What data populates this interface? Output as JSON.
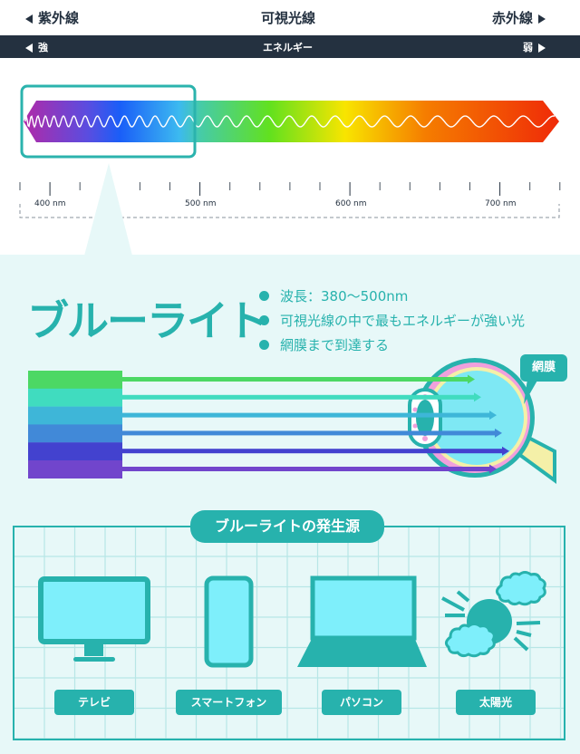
{
  "header": {
    "left_label": "紫外線",
    "center_label": "可視光線",
    "right_label": "赤外線"
  },
  "energy_bar": {
    "left_label": "強",
    "center_label": "エネルギー",
    "right_label": "弱"
  },
  "spectrum": {
    "scale_labels": [
      "400 nm",
      "500 nm",
      "600 nm",
      "700 nm"
    ],
    "gradient_colors": [
      "#a92fb6",
      "#1f5ef6",
      "#3ab9f2",
      "#58dd2c",
      "#f8e400",
      "#f47a00",
      "#ef2d08"
    ],
    "highlight_color": "#2bb3ad"
  },
  "blue_light": {
    "title": "ブルーライト",
    "facts": [
      "波長：380〜500nm",
      "可視光線の中で最もエネルギーが強い光",
      "網膜まで到達する"
    ],
    "retina_label": "網膜",
    "ray_colors": [
      "#4cd864",
      "#40dcbf",
      "#3eb6d8",
      "#4189d8",
      "#4342cf",
      "#7145cc"
    ]
  },
  "sources": {
    "title": "ブルーライトの発生源",
    "items": [
      {
        "label": "テレビ",
        "icon": "tv-icon"
      },
      {
        "label": "スマートフォン",
        "icon": "smartphone-icon"
      },
      {
        "label": "パソコン",
        "icon": "laptop-icon"
      },
      {
        "label": "太陽光",
        "icon": "sun-icon"
      }
    ]
  },
  "colors": {
    "dark": "#243140",
    "accent": "#27b2ad",
    "screen": "#7eeffb",
    "background_light": "#e7f8f8"
  }
}
